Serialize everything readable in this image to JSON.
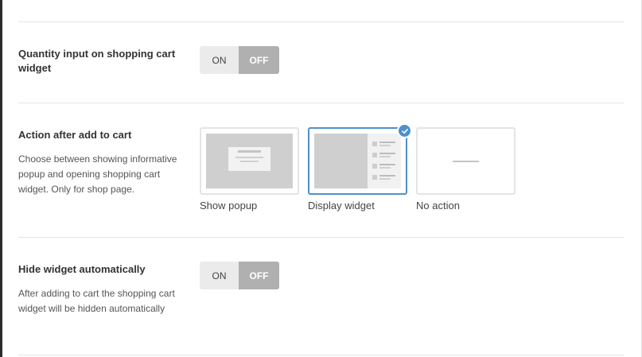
{
  "settings": {
    "quantity_input": {
      "label": "Quantity input on shopping cart widget",
      "toggle": {
        "on_label": "ON",
        "off_label": "OFF",
        "value": "OFF"
      }
    },
    "action_after_add": {
      "label": "Action after add to cart",
      "description": "Choose between showing informative popup and opening shopping cart widget. Only for shop page.",
      "options": [
        {
          "label": "Show popup",
          "selected": false
        },
        {
          "label": "Display widget",
          "selected": true
        },
        {
          "label": "No action",
          "selected": false
        }
      ],
      "accent_color": "#4f8fcd"
    },
    "hide_widget": {
      "label": "Hide widget automatically",
      "description": "After adding to cart the shopping cart widget will be hidden automatically",
      "toggle": {
        "on_label": "ON",
        "off_label": "OFF",
        "value": "OFF"
      }
    }
  }
}
